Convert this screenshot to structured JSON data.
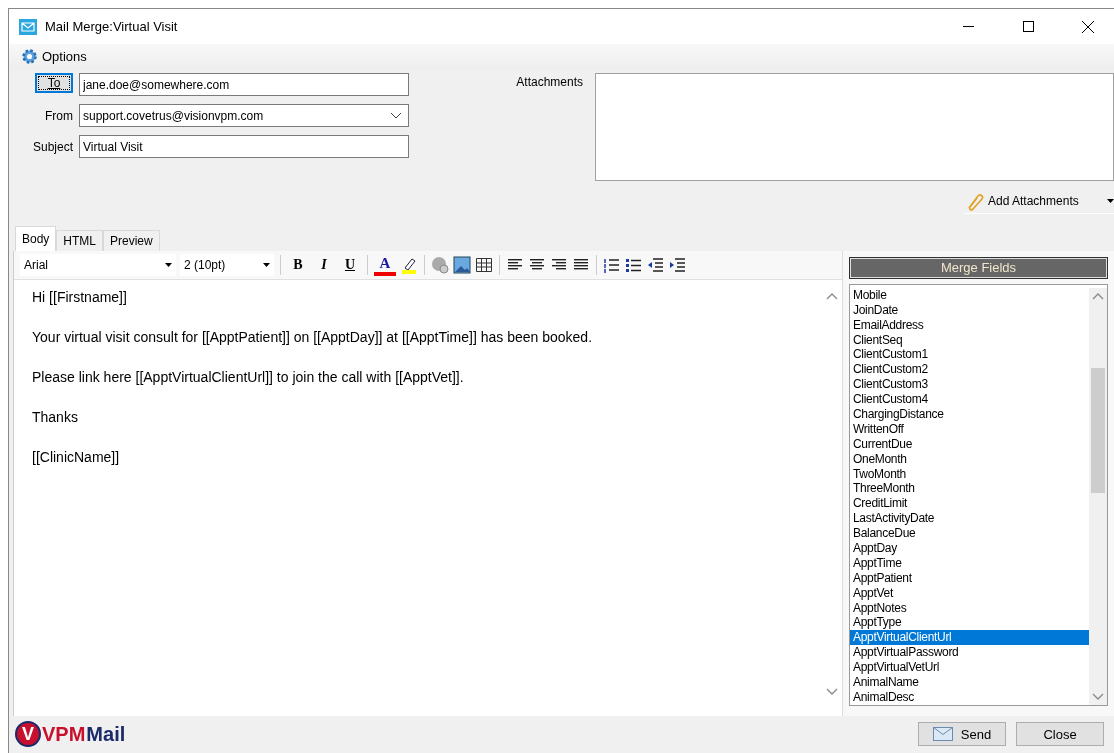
{
  "window": {
    "title": "Mail Merge:Virtual Visit"
  },
  "options": {
    "label": "Options"
  },
  "fields": {
    "to_button": "To",
    "to": "jane.doe@somewhere.com",
    "from_label": "From",
    "from": "support.covetrus@visionvpm.com",
    "subject_label": "Subject",
    "subject": "Virtual Visit"
  },
  "attachments": {
    "label": "Attachments",
    "add_button": "Add Attachments"
  },
  "tabs": [
    {
      "label": "Body",
      "selected": true
    },
    {
      "label": "HTML",
      "selected": false
    },
    {
      "label": "Preview",
      "selected": false
    }
  ],
  "toolbar": {
    "font": "Arial",
    "size": "2 (10pt)",
    "bold": "B",
    "italic": "I",
    "underline": "U",
    "font_color": "A"
  },
  "body": [
    "Hi [[Firstname]]",
    "Your virtual visit consult for [[ApptPatient]] on [[ApptDay]] at [[ApptTime]] has been booked.",
    "Please link here [[ApptVirtualClientUrl]] to join the call with [[ApptVet]].",
    "Thanks",
    "[[ClinicName]]"
  ],
  "merge_fields": {
    "title": "Merge Fields",
    "items": [
      {
        "label": "Mobile",
        "selected": false
      },
      {
        "label": "JoinDate",
        "selected": false
      },
      {
        "label": "EmailAddress",
        "selected": false
      },
      {
        "label": "ClientSeq",
        "selected": false
      },
      {
        "label": "ClientCustom1",
        "selected": false
      },
      {
        "label": "ClientCustom2",
        "selected": false
      },
      {
        "label": "ClientCustom3",
        "selected": false
      },
      {
        "label": "ClientCustom4",
        "selected": false
      },
      {
        "label": "ChargingDistance",
        "selected": false
      },
      {
        "label": "WrittenOff",
        "selected": false
      },
      {
        "label": "CurrentDue",
        "selected": false
      },
      {
        "label": "OneMonth",
        "selected": false
      },
      {
        "label": "TwoMonth",
        "selected": false
      },
      {
        "label": "ThreeMonth",
        "selected": false
      },
      {
        "label": "CreditLimit",
        "selected": false
      },
      {
        "label": "LastActivityDate",
        "selected": false
      },
      {
        "label": "BalanceDue",
        "selected": false
      },
      {
        "label": "ApptDay",
        "selected": false
      },
      {
        "label": "ApptTime",
        "selected": false
      },
      {
        "label": "ApptPatient",
        "selected": false
      },
      {
        "label": "ApptVet",
        "selected": false
      },
      {
        "label": "ApptNotes",
        "selected": false
      },
      {
        "label": "ApptType",
        "selected": false
      },
      {
        "label": "ApptVirtualClientUrl",
        "selected": true
      },
      {
        "label": "ApptVirtualPassword",
        "selected": false
      },
      {
        "label": "ApptVirtualVetUrl",
        "selected": false
      },
      {
        "label": "AnimalName",
        "selected": false
      },
      {
        "label": "AnimalDesc",
        "selected": false
      }
    ]
  },
  "logo": {
    "badge": "V",
    "brand": "VPM",
    "product": "Mail"
  },
  "buttons": [
    {
      "kind": "send",
      "label": "Send"
    },
    {
      "kind": "close",
      "label": "Close"
    }
  ]
}
